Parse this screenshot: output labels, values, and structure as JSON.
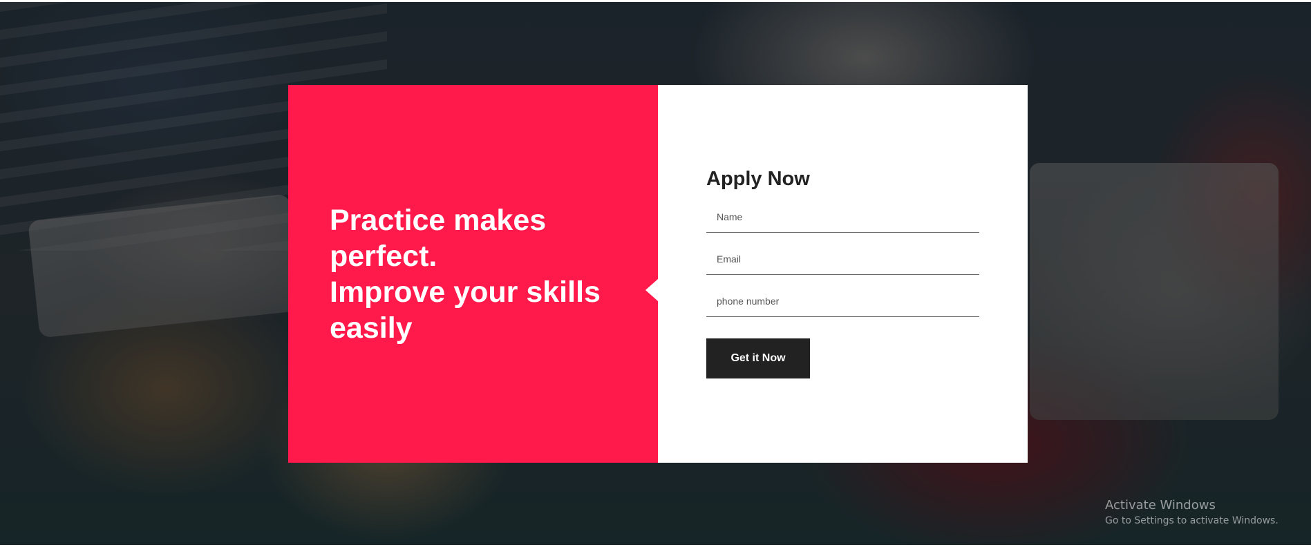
{
  "promo": {
    "line1": "Practice makes",
    "line2": "perfect.",
    "line3": "Improve your skills",
    "line4": "easily"
  },
  "form": {
    "title": "Apply Now",
    "name_placeholder": "Name",
    "email_placeholder": "Email",
    "phone_placeholder": "phone number",
    "submit_label": "Get it Now"
  },
  "watermark": {
    "title": "Activate Windows",
    "subtitle": "Go to Settings to activate Windows."
  },
  "colors": {
    "accent": "#ff1a4b",
    "button": "#222222",
    "panel": "#ffffff"
  }
}
